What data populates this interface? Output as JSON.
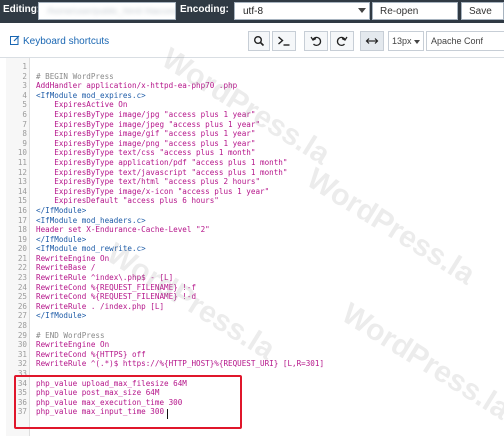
{
  "topbar": {
    "editing_label": "Editing:",
    "filename": "/home/user/public_html/.htaccess",
    "encoding_label": "Encoding:",
    "encoding_value": "utf-8",
    "reopen_label": "Re-open",
    "save_label": "Save"
  },
  "toolbar": {
    "keyboard_shortcuts": "Keyboard shortcuts",
    "font_size": "13px",
    "mode": "Apache Conf"
  },
  "watermark_text": "WordPress.la",
  "editor": {
    "lines": [
      {
        "n": "1",
        "text": ""
      },
      {
        "n": "2",
        "text": "# BEGIN WordPress",
        "kind": "comment"
      },
      {
        "n": "3",
        "text": "AddHandler application/x-httpd-ea-php70 .php",
        "kind": "directive"
      },
      {
        "n": "4",
        "text": "<IfModule mod_expires.c>",
        "kind": "tag"
      },
      {
        "n": "5",
        "text": "    ExpiresActive On",
        "kind": "directive"
      },
      {
        "n": "6",
        "text": "    ExpiresByType image/jpg \"access plus 1 year\"",
        "kind": "directive"
      },
      {
        "n": "7",
        "text": "    ExpiresByType image/jpeg \"access plus 1 year\"",
        "kind": "directive"
      },
      {
        "n": "8",
        "text": "    ExpiresByType image/gif \"access plus 1 year\"",
        "kind": "directive"
      },
      {
        "n": "9",
        "text": "    ExpiresByType image/png \"access plus 1 year\"",
        "kind": "directive"
      },
      {
        "n": "10",
        "text": "    ExpiresByType text/css \"access plus 1 month\"",
        "kind": "directive"
      },
      {
        "n": "11",
        "text": "    ExpiresByType application/pdf \"access plus 1 month\"",
        "kind": "directive"
      },
      {
        "n": "12",
        "text": "    ExpiresByType text/javascript \"access plus 1 month\"",
        "kind": "directive"
      },
      {
        "n": "13",
        "text": "    ExpiresByType text/html \"access plus 2 hours\"",
        "kind": "directive"
      },
      {
        "n": "14",
        "text": "    ExpiresByType image/x-icon \"access plus 1 year\"",
        "kind": "directive"
      },
      {
        "n": "15",
        "text": "    ExpiresDefault \"access plus 6 hours\"",
        "kind": "directive"
      },
      {
        "n": "16",
        "text": "</IfModule>",
        "kind": "tag"
      },
      {
        "n": "17",
        "text": "<IfModule mod_headers.c>",
        "kind": "tag"
      },
      {
        "n": "18",
        "text": "Header set X-Endurance-Cache-Level \"2\"",
        "kind": "directive"
      },
      {
        "n": "19",
        "text": "</IfModule>",
        "kind": "tag"
      },
      {
        "n": "20",
        "text": "<IfModule mod_rewrite.c>",
        "kind": "tag"
      },
      {
        "n": "21",
        "text": "RewriteEngine On",
        "kind": "directive"
      },
      {
        "n": "22",
        "text": "RewriteBase /",
        "kind": "directive"
      },
      {
        "n": "23",
        "text": "RewriteRule ^index\\.php$ - [L]",
        "kind": "directive"
      },
      {
        "n": "24",
        "text": "RewriteCond %{REQUEST_FILENAME} !-f",
        "kind": "directive"
      },
      {
        "n": "25",
        "text": "RewriteCond %{REQUEST_FILENAME} !-d",
        "kind": "directive"
      },
      {
        "n": "26",
        "text": "RewriteRule . /index.php [L]",
        "kind": "directive"
      },
      {
        "n": "27",
        "text": "</IfModule>",
        "kind": "tag"
      },
      {
        "n": "28",
        "text": ""
      },
      {
        "n": "29",
        "text": "# END WordPress",
        "kind": "comment"
      },
      {
        "n": "30",
        "text": "RewriteEngine On",
        "kind": "directive"
      },
      {
        "n": "31",
        "text": "RewriteCond %{HTTPS} off",
        "kind": "directive"
      },
      {
        "n": "32",
        "text": "RewriteRule ^(.*)$ https://%{HTTP_HOST}%{REQUEST_URI} [L,R=301]",
        "kind": "directive"
      },
      {
        "n": "33",
        "text": ""
      },
      {
        "n": "34",
        "text": "php_value upload_max_filesize 64M",
        "kind": "directive"
      },
      {
        "n": "35",
        "text": "php_value post_max_size 64M",
        "kind": "directive"
      },
      {
        "n": "36",
        "text": "php_value max_execution_time 300",
        "kind": "directive"
      },
      {
        "n": "37",
        "text": "php_value max_input_time 300",
        "kind": "directive"
      }
    ]
  },
  "colors": {
    "topbar_bg": "#303a44",
    "comment": "#8a8a8a",
    "directive": "#b5158a",
    "tag": "#1e5ca8",
    "link": "#1a67b3",
    "highlight": "#e0162b"
  }
}
